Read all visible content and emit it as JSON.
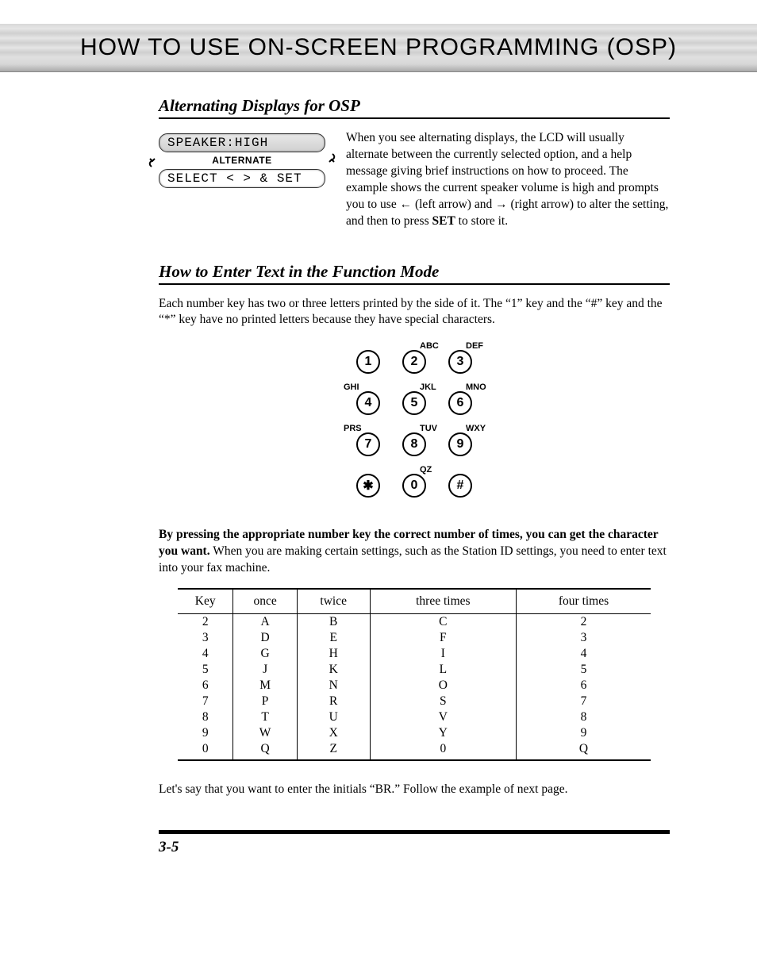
{
  "banner": {
    "title": "HOW TO USE ON-SCREEN PROGRAMMING (OSP)"
  },
  "section1": {
    "title": "Alternating Displays for OSP",
    "lcd_top": "SPEAKER:HIGH",
    "lcd_alt_label": "ALTERNATE",
    "lcd_bottom": "SELECT < > & SET",
    "text": "When you see alternating displays, the LCD will usually alternate between the currently selected option, and a help message giving brief instructions on how to proceed. The example shows the current speaker volume is high and prompts you to use ← (left arrow) and → (right arrow) to alter the setting, and then to press SET to store it."
  },
  "section2": {
    "title": "How to Enter Text in the Function Mode",
    "intro": "Each number key has two or three letters printed by the side of it. The “1” key and the “#” key and the “*” key have no printed letters because they have special characters.",
    "keypad": {
      "keys": [
        "1",
        "2",
        "3",
        "4",
        "5",
        "6",
        "7",
        "8",
        "9",
        "*",
        "0",
        "#"
      ],
      "labels": {
        "1": "",
        "2": "ABC",
        "3": "DEF",
        "4": "GHI",
        "5": "JKL",
        "6": "MNO",
        "7": "PRS",
        "8": "TUV",
        "9": "WXY",
        "*": "",
        "0": "QZ",
        "#": ""
      },
      "label_pos": {
        "1": "none",
        "2": "top-right",
        "3": "top-right",
        "4": "top-left",
        "5": "top-right",
        "6": "top-right",
        "7": "top-left",
        "8": "top-right",
        "9": "top-right",
        "*": "none",
        "0": "top-right",
        "#": "none"
      }
    },
    "para2_bold": "By pressing the appropriate number key the correct number of times, you can get the character you want.",
    "para2_rest": " When you are making certain settings, such as the Station ID settings, you need to enter text into your fax machine.",
    "table": {
      "headers": [
        "Key",
        "once",
        "twice",
        "three times",
        "four times"
      ],
      "rows": [
        [
          "2",
          "A",
          "B",
          "C",
          "2"
        ],
        [
          "3",
          "D",
          "E",
          "F",
          "3"
        ],
        [
          "4",
          "G",
          "H",
          "I",
          "4"
        ],
        [
          "5",
          "J",
          "K",
          "L",
          "5"
        ],
        [
          "6",
          "M",
          "N",
          "O",
          "6"
        ],
        [
          "7",
          "P",
          "R",
          "S",
          "7"
        ],
        [
          "8",
          "T",
          "U",
          "V",
          "8"
        ],
        [
          "9",
          "W",
          "X",
          "Y",
          "9"
        ],
        [
          "0",
          "Q",
          "Z",
          "0",
          "Q"
        ]
      ]
    },
    "outro": "Let's say that you want to enter the initials “BR.” Follow the example of next page."
  },
  "page_number": "3-5"
}
